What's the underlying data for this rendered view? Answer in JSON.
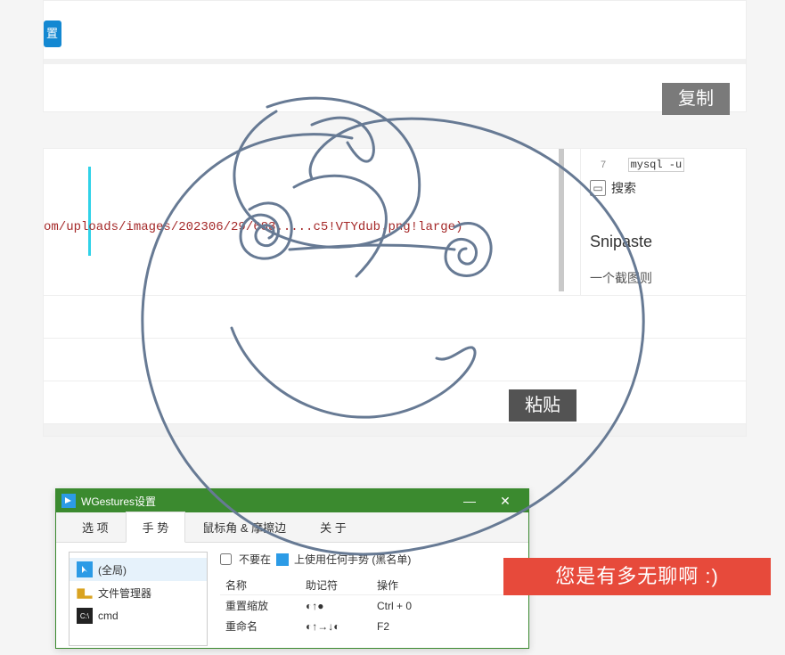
{
  "panel1": {
    "blue_btn_label": "置",
    "copy_btn_label": "复制"
  },
  "panel2": {
    "code_text": "om/uploads/images/202306/29/683.....c5!VTYdub.png!large)",
    "paste_btn_label": "粘贴",
    "sidebar": {
      "mysql_num": "7",
      "mysql_text": "mysql -u",
      "search_label": "搜索",
      "title": "Snipaste",
      "desc": "一个截图则"
    }
  },
  "wgestures": {
    "window_title": "WGestures设置",
    "tabs": [
      "选 项",
      "手 势",
      "鼠标角 & 摩擦边",
      "关 于"
    ],
    "active_tab_index": 1,
    "left_items": [
      {
        "label": "(全局)",
        "icon": "cursor"
      },
      {
        "label": "文件管理器",
        "icon": "explorer"
      },
      {
        "label": "cmd",
        "icon": "cmd"
      }
    ],
    "right": {
      "check_prefix": "不要在",
      "check_suffix": "上使用任何手势 (黑名单)",
      "headers": [
        "名称",
        "助记符",
        "操作"
      ],
      "rows": [
        {
          "name": "重置缩放",
          "mnemonic": "◐↑●",
          "op": "Ctrl + 0"
        },
        {
          "name": "重命名",
          "mnemonic": "◐↑→↓◐",
          "op": "F2"
        }
      ]
    }
  },
  "banner": {
    "text": "您是有多无聊啊 :)"
  }
}
